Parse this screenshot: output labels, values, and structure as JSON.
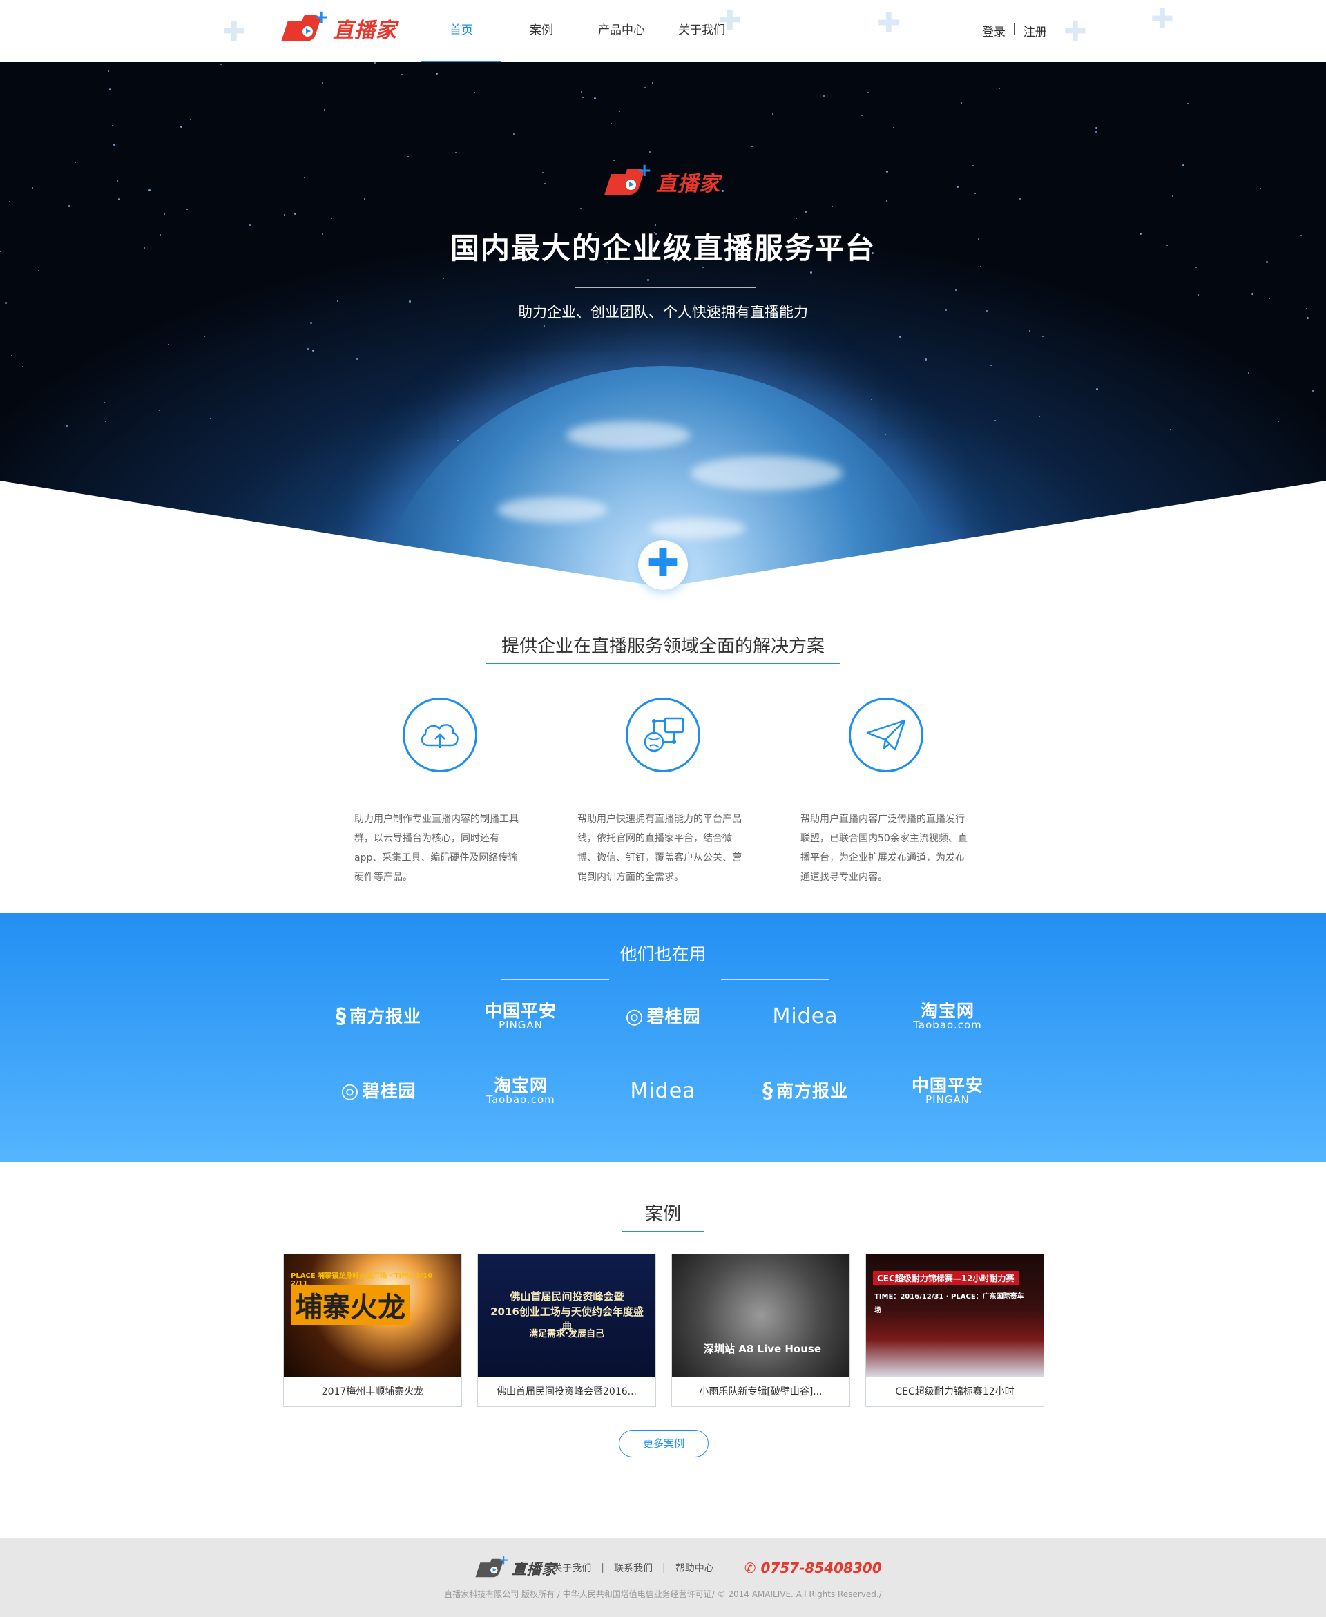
{
  "brand": {
    "name": "直播家"
  },
  "nav": {
    "items": [
      {
        "label": "首页",
        "active": true
      },
      {
        "label": "案例",
        "active": false
      },
      {
        "label": "产品中心",
        "active": false
      },
      {
        "label": "关于我们",
        "active": false
      }
    ],
    "login": "登录",
    "divider": "|",
    "register": "注册"
  },
  "hero": {
    "title": "国内最大的企业级直播服务平台",
    "subtitle": "助力企业、创业团队、个人快速拥有直播能力"
  },
  "solutions": {
    "title": "提供企业在直播服务领域全面的解决方案",
    "items": [
      {
        "icon": "cloud-upload-icon",
        "text": "助力用户制作专业直播内容的制播工具群，以云导播台为核心，同时还有app、采集工具、编码硬件及网络传输硬件等产品。"
      },
      {
        "icon": "platform-network-icon",
        "text": "帮助用户快速拥有直播能力的平台产品线，依托官网的直播家平台，结合微博、微信、钉钉，覆盖客户从公关、营销到内训方面的全需求。"
      },
      {
        "icon": "paper-plane-icon",
        "text": "帮助用户直播内容广泛传播的直播发行联盟，已联合国内50余家主流视频、直播平台，为企业扩展发布通道，为发布通道找寻专业内容。"
      }
    ]
  },
  "clients": {
    "title": "他们也在用",
    "logos": [
      {
        "name": "南方报业",
        "sub": ""
      },
      {
        "name": "中国平安",
        "sub": "PINGAN"
      },
      {
        "name": "碧桂园",
        "sub": ""
      },
      {
        "name": "Midea",
        "sub": ""
      },
      {
        "name": "淘宝网",
        "sub": "Taobao.com"
      },
      {
        "name": "碧桂园",
        "sub": ""
      },
      {
        "name": "淘宝网",
        "sub": "Taobao.com"
      },
      {
        "name": "Midea",
        "sub": ""
      },
      {
        "name": "南方报业",
        "sub": ""
      },
      {
        "name": "中国平安",
        "sub": "PINGAN"
      }
    ]
  },
  "cases": {
    "title": "案例",
    "items": [
      {
        "caption": "2017梅州丰顺埔寨火龙",
        "thumb_text": "埔寨火龙",
        "thumb_sub": "PLACE 埔寨镇龙身岭火龙广场 · TIME 2/10 2/11"
      },
      {
        "caption": "佛山首届民间投资峰会暨2016...",
        "thumb_text": "佛山首届民间投资峰会暨\n2016创业工场与天使约会年度盛典",
        "thumb_sub": "满足需求·发展自己"
      },
      {
        "caption": "小雨乐队新专辑[破壁山谷]...",
        "thumb_text": "深圳站 A8 Live House",
        "thumb_sub": ""
      },
      {
        "caption": "CEC超级耐力锦标赛12小时",
        "thumb_text": "CEC超级耐力锦标赛—12小时耐力赛",
        "thumb_sub": "TIME：2016/12/31 · PLACE：广东国际赛车场"
      }
    ],
    "more": "更多案例"
  },
  "footer": {
    "links": [
      "关于我们",
      "联系我们",
      "帮助中心"
    ],
    "divider": "|",
    "phone": "0757-85408300",
    "copyright": "直播家科技有限公司 版权所有 / 中华人民共和国增值电信业务经营许可证/ © 2014 AMAILIVE. All Rights Reserved./"
  },
  "colors": {
    "accent": "#1f8ef1",
    "brand_red": "#e8372c",
    "footer_bg": "#e7e7e7"
  }
}
